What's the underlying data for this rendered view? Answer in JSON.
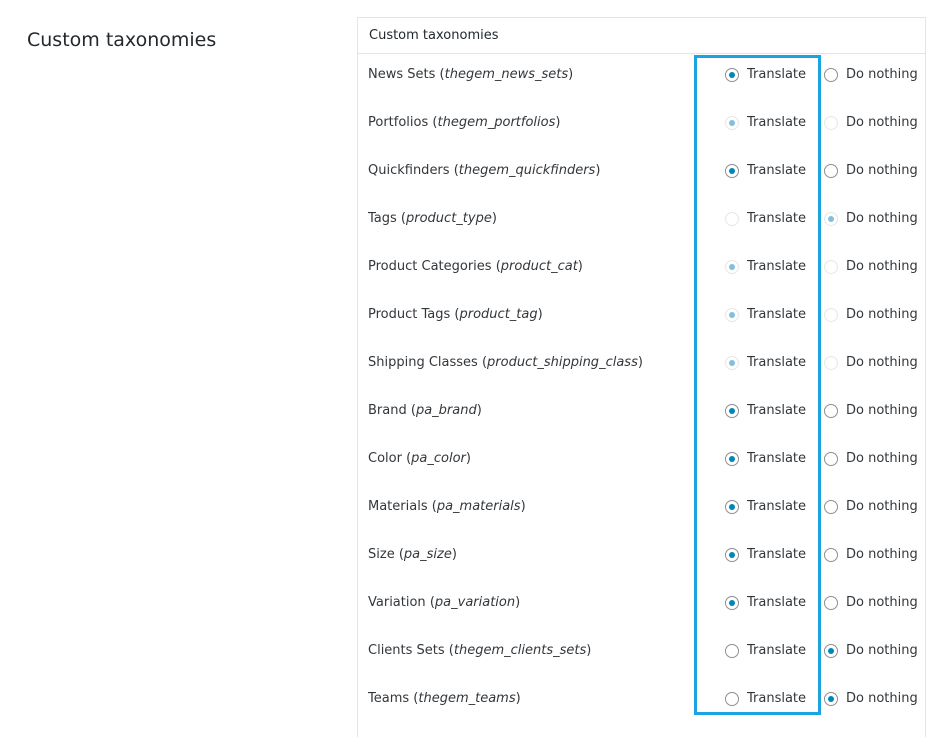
{
  "section": {
    "title": "Custom taxonomies"
  },
  "panel": {
    "header": "Custom taxonomies",
    "options": {
      "translate": "Translate",
      "nothing": "Do nothing"
    },
    "rows": [
      {
        "name": "News Sets",
        "slug": "thegem_news_sets",
        "selected": "translate",
        "disabled": false
      },
      {
        "name": "Portfolios",
        "slug": "thegem_portfolios",
        "selected": "translate",
        "disabled": true
      },
      {
        "name": "Quickfinders",
        "slug": "thegem_quickfinders",
        "selected": "translate",
        "disabled": false
      },
      {
        "name": "Tags",
        "slug": "product_type",
        "selected": "nothing",
        "disabled": true
      },
      {
        "name": "Product Categories",
        "slug": "product_cat",
        "selected": "translate",
        "disabled": true
      },
      {
        "name": "Product Tags",
        "slug": "product_tag",
        "selected": "translate",
        "disabled": true
      },
      {
        "name": "Shipping Classes",
        "slug": "product_shipping_class",
        "selected": "translate",
        "disabled": true
      },
      {
        "name": "Brand",
        "slug": "pa_brand",
        "selected": "translate",
        "disabled": false
      },
      {
        "name": "Color",
        "slug": "pa_color",
        "selected": "translate",
        "disabled": false
      },
      {
        "name": "Materials",
        "slug": "pa_materials",
        "selected": "translate",
        "disabled": false
      },
      {
        "name": "Size",
        "slug": "pa_size",
        "selected": "translate",
        "disabled": false
      },
      {
        "name": "Variation",
        "slug": "pa_variation",
        "selected": "translate",
        "disabled": false
      },
      {
        "name": "Clients Sets",
        "slug": "thegem_clients_sets",
        "selected": "nothing",
        "disabled": false
      },
      {
        "name": "Teams",
        "slug": "thegem_teams",
        "selected": "nothing",
        "disabled": false
      }
    ]
  },
  "colors": {
    "accent": "#0085ba",
    "highlight": "#1ba4e0",
    "disabled_dot": "#7fc1dc"
  }
}
